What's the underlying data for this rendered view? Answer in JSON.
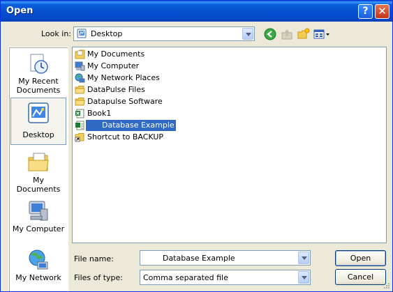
{
  "window": {
    "title": "Open",
    "help_label": "?",
    "close_label": "✕"
  },
  "lookin": {
    "label": "Look in:",
    "value": "Desktop"
  },
  "toolbar": {
    "back": "back-icon",
    "up": "up-folder-icon",
    "new_folder": "new-folder-icon",
    "views": "views-menu-icon"
  },
  "places": [
    {
      "label": "My Recent Documents",
      "icon": "recent-documents-icon"
    },
    {
      "label": "Desktop",
      "icon": "desktop-icon"
    },
    {
      "label": "My Documents",
      "icon": "my-documents-icon"
    },
    {
      "label": "My Computer",
      "icon": "my-computer-icon"
    },
    {
      "label": "My Network",
      "icon": "my-network-icon"
    }
  ],
  "files": [
    {
      "name": "My Documents",
      "icon": "my-documents-icon"
    },
    {
      "name": "My Computer",
      "icon": "my-computer-icon"
    },
    {
      "name": "My Network Places",
      "icon": "network-places-icon"
    },
    {
      "name": "DataPulse Files",
      "icon": "folder-icon"
    },
    {
      "name": "Datapulse Software",
      "icon": "folder-icon"
    },
    {
      "name": "Book1",
      "icon": "excel-file-icon"
    },
    {
      "name": "      Database Example",
      "icon": "csv-file-icon",
      "selected": true
    },
    {
      "name": "Shortcut to BACKUP",
      "icon": "shortcut-folder-icon"
    }
  ],
  "filename": {
    "label": "File name:",
    "value": "        Database Example"
  },
  "filetype": {
    "label": "Files of type:",
    "value": "Comma separated file"
  },
  "buttons": {
    "open": "Open",
    "cancel": "Cancel"
  },
  "colors": {
    "title_bar": "#0550d0",
    "selection": "#316ac5",
    "dialog_bg": "#ece9d8"
  }
}
